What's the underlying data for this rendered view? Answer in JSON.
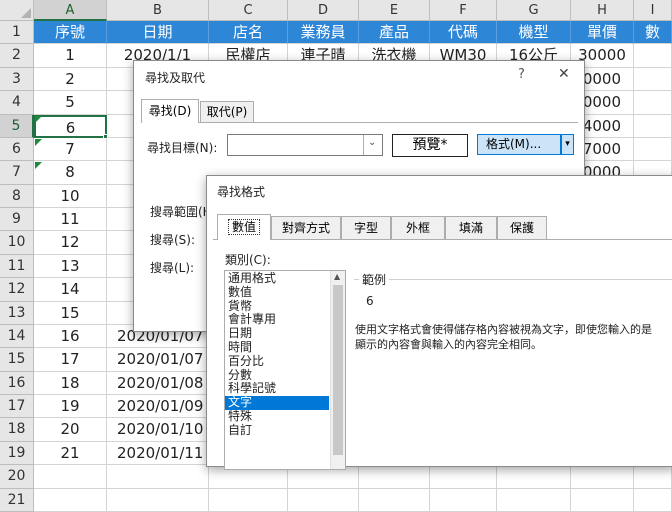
{
  "columns": [
    "A",
    "B",
    "C",
    "D",
    "E",
    "F",
    "G",
    "H",
    "I"
  ],
  "rows": [
    "1",
    "2",
    "3",
    "4",
    "5",
    "6",
    "7",
    "8",
    "9",
    "10",
    "11",
    "12",
    "13",
    "14",
    "15",
    "16",
    "17",
    "18",
    "19",
    "20",
    "21"
  ],
  "header_cells": [
    "序號",
    "日期",
    "店名",
    "業務員",
    "產品",
    "代碼",
    "機型",
    "單價",
    "數"
  ],
  "col_a": [
    "1",
    "2",
    "5",
    "6",
    "7",
    "8",
    "10",
    "11",
    "12",
    "13",
    "14",
    "15",
    "16",
    "17",
    "18",
    "19",
    "20",
    "21"
  ],
  "col_b": [
    "2020/1/1",
    "2",
    "2",
    "2",
    "20",
    "20",
    "20",
    "20",
    "20",
    "20",
    "20",
    "20",
    "2020/01/07",
    "2020/01/07",
    "2020/01/08",
    "2020/01/09",
    "2020/01/10",
    "2020/01/11"
  ],
  "row2": {
    "store": "民權店",
    "sales": "連子晴",
    "product": "洗衣機",
    "code": "WM30",
    "model": "16公斤",
    "price": "30000"
  },
  "col_h": [
    "0000",
    "0000",
    "4000",
    "7000",
    "0000"
  ],
  "find_dialog": {
    "title": "尋找及取代",
    "help": "?",
    "close": "✕",
    "tabs": [
      "尋找(D)",
      "取代(P)"
    ],
    "find_label": "尋找目標(N):",
    "find_value": "",
    "preview_label": "預覽*",
    "format_label": "格式(M)...",
    "format_arrow": "▾",
    "search_range_label": "搜尋範圍(H",
    "search_label": "搜尋(S):",
    "look_in_label": "搜尋(L):"
  },
  "format_dialog": {
    "title": "尋找格式",
    "tabs": [
      "數值",
      "對齊方式",
      "字型",
      "外框",
      "填滿",
      "保護"
    ],
    "category_label": "類別(C):",
    "categories": [
      "通用格式",
      "數值",
      "貨幣",
      "會計專用",
      "日期",
      "時間",
      "百分比",
      "分數",
      "科學記號",
      "文字",
      "特殊",
      "自訂"
    ],
    "selected_category": "文字",
    "sample_label": "範例",
    "sample_value": "6",
    "description": "使用文字格式會使得儲存格內容被視為文字，即使您輸入的是數字也一樣。顯示的內容會與輸入的內容完全相同。",
    "description_visible_line1": "使用文字格式會使得儲存格內容被視為文字，即使您輸入的是",
    "description_visible_line2": "顯示的內容會與輸入的內容完全相同。"
  }
}
